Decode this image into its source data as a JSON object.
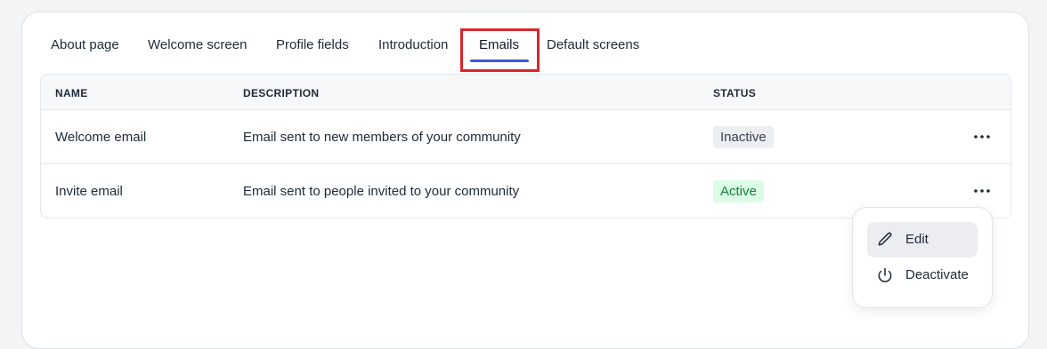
{
  "tabs": [
    {
      "label": "About page"
    },
    {
      "label": "Welcome screen"
    },
    {
      "label": "Profile fields"
    },
    {
      "label": "Introduction"
    },
    {
      "label": "Emails"
    },
    {
      "label": "Default screens"
    }
  ],
  "active_tab": "Emails",
  "table": {
    "columns": [
      "NAME",
      "DESCRIPTION",
      "STATUS"
    ],
    "rows": [
      {
        "name": "Welcome email",
        "description": "Email sent to new members of your community",
        "status": "Inactive"
      },
      {
        "name": "Invite email",
        "description": "Email sent to people invited to your community",
        "status": "Active"
      }
    ]
  },
  "menu": {
    "items": [
      {
        "label": "Edit",
        "icon": "pencil-icon"
      },
      {
        "label": "Deactivate",
        "icon": "power-icon"
      }
    ]
  },
  "colors": {
    "accent": "#3b5bdb",
    "highlight_box": "#d9262b",
    "active_badge_bg": "#dcfce7",
    "inactive_badge_bg": "#eceef1"
  }
}
